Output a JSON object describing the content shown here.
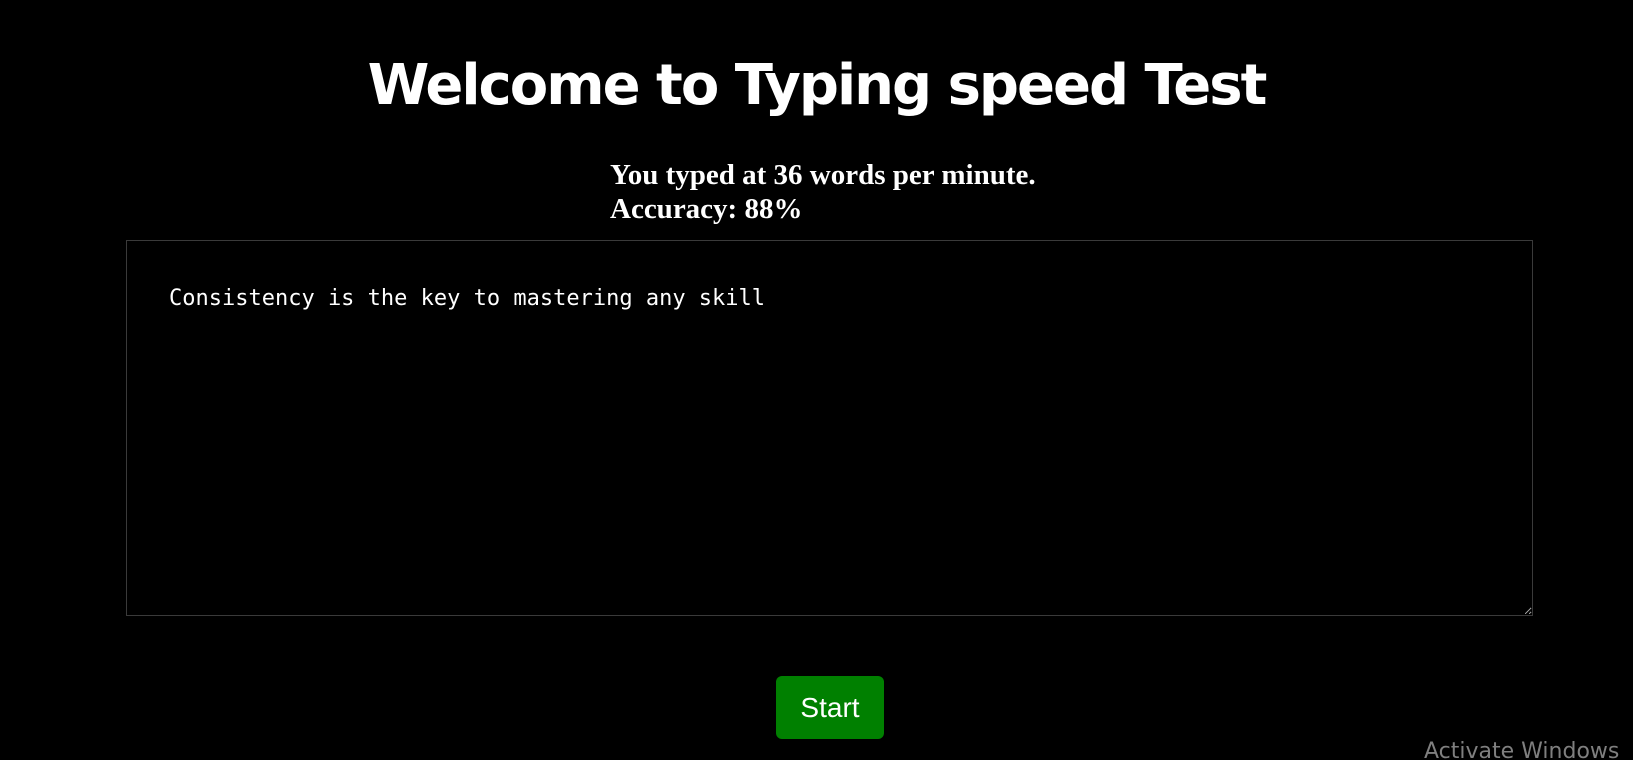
{
  "header": {
    "title": "Welcome to Typing speed Test"
  },
  "results": {
    "speed_text": "You typed at 36 words per minute.",
    "accuracy_text": "Accuracy: 88%"
  },
  "typing_area": {
    "value": "Consistency is the key to mastering any skill"
  },
  "controls": {
    "start_label": "Start"
  },
  "watermark": {
    "text": "Activate Windows"
  },
  "colors": {
    "background": "#000000",
    "text": "#ffffff",
    "start_button": "#008000",
    "watermark": "#7f7f7f"
  }
}
